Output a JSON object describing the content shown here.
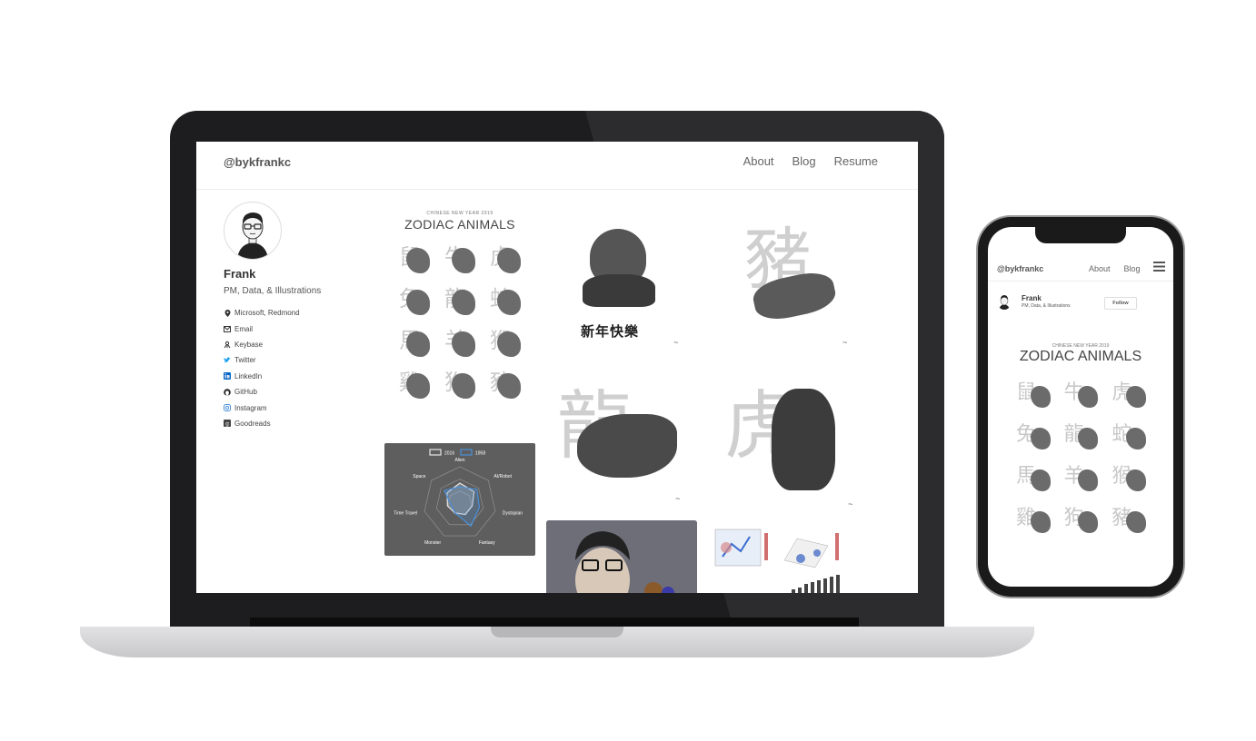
{
  "site": {
    "brand": "@bykfrankc",
    "nav": [
      "About",
      "Blog",
      "Resume"
    ]
  },
  "profile": {
    "name": "Frank",
    "bio": "PM, Data, & Illustrations",
    "links": [
      {
        "label": "Microsoft, Redmond",
        "icon": "location-icon"
      },
      {
        "label": "Email",
        "icon": "email-icon"
      },
      {
        "label": "Keybase",
        "icon": "keybase-icon"
      },
      {
        "label": "Twitter",
        "icon": "twitter-icon"
      },
      {
        "label": "LinkedIn",
        "icon": "linkedin-icon"
      },
      {
        "label": "GitHub",
        "icon": "github-icon"
      },
      {
        "label": "Instagram",
        "icon": "instagram-icon"
      },
      {
        "label": "Goodreads",
        "icon": "goodreads-icon"
      }
    ]
  },
  "zodiac": {
    "subtitle": "CHINESE NEW YEAR 2019",
    "title": "ZODIAC ANIMALS",
    "glyphs": [
      "鼠",
      "牛",
      "虎",
      "兔",
      "龍",
      "蛇",
      "馬",
      "羊",
      "猴",
      "雞",
      "狗",
      "豬"
    ]
  },
  "lion_tile": {
    "caption": "新年快樂"
  },
  "pig_tile": {
    "glyph": "豬"
  },
  "dragon_tile": {
    "glyph": "龍"
  },
  "tiger_tile": {
    "glyph": "虎"
  },
  "chart_data": {
    "type": "radar",
    "categories": [
      "Alien",
      "AI/Robot",
      "Dystopian",
      "Fantasy",
      "Monster",
      "Time Travel",
      "Space"
    ],
    "series": [
      {
        "name": "2016",
        "values": [
          0.55,
          0.5,
          0.35,
          0.35,
          0.3,
          0.35,
          0.45
        ]
      },
      {
        "name": "1958",
        "values": [
          0.45,
          0.6,
          0.55,
          0.7,
          0.3,
          0.25,
          0.55
        ]
      }
    ],
    "colors": {
      "2016": "#e6e6e6",
      "1958": "#4a90d9"
    }
  },
  "phone": {
    "brand": "@bykfrankc",
    "nav": [
      "About",
      "Blog"
    ],
    "menu_icon": "hamburger-icon",
    "name": "Frank",
    "bio": "PM, Data, & Illustrations",
    "follow": "Follow",
    "subtitle": "CHINESE NEW YEAR 2019",
    "title": "ZODIAC ANIMALS"
  },
  "colors": {
    "accent": "#4a90d9",
    "twitter": "#1da1f2",
    "linkedin": "#0a66c2",
    "instagram": "#c13584"
  }
}
